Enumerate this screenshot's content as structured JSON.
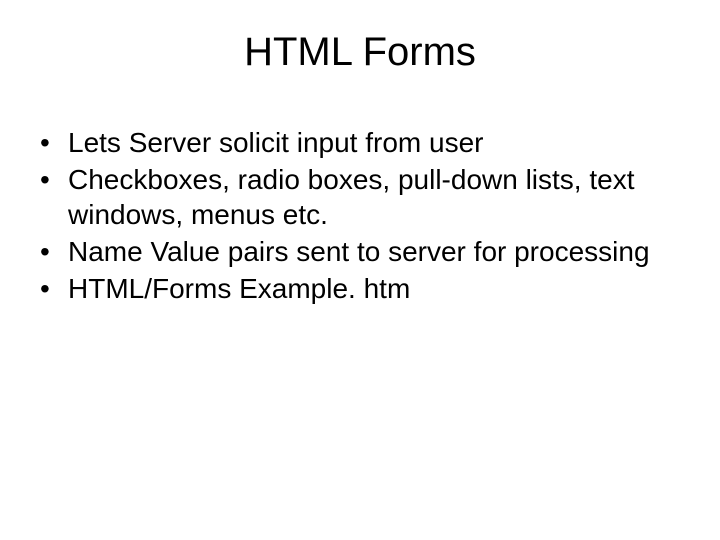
{
  "title": "HTML Forms",
  "bullets": [
    "Lets Server solicit input from user",
    "Checkboxes, radio boxes, pull-down lists, text windows, menus etc.",
    "Name Value pairs sent to server for processing",
    "HTML/Forms Example. htm"
  ]
}
